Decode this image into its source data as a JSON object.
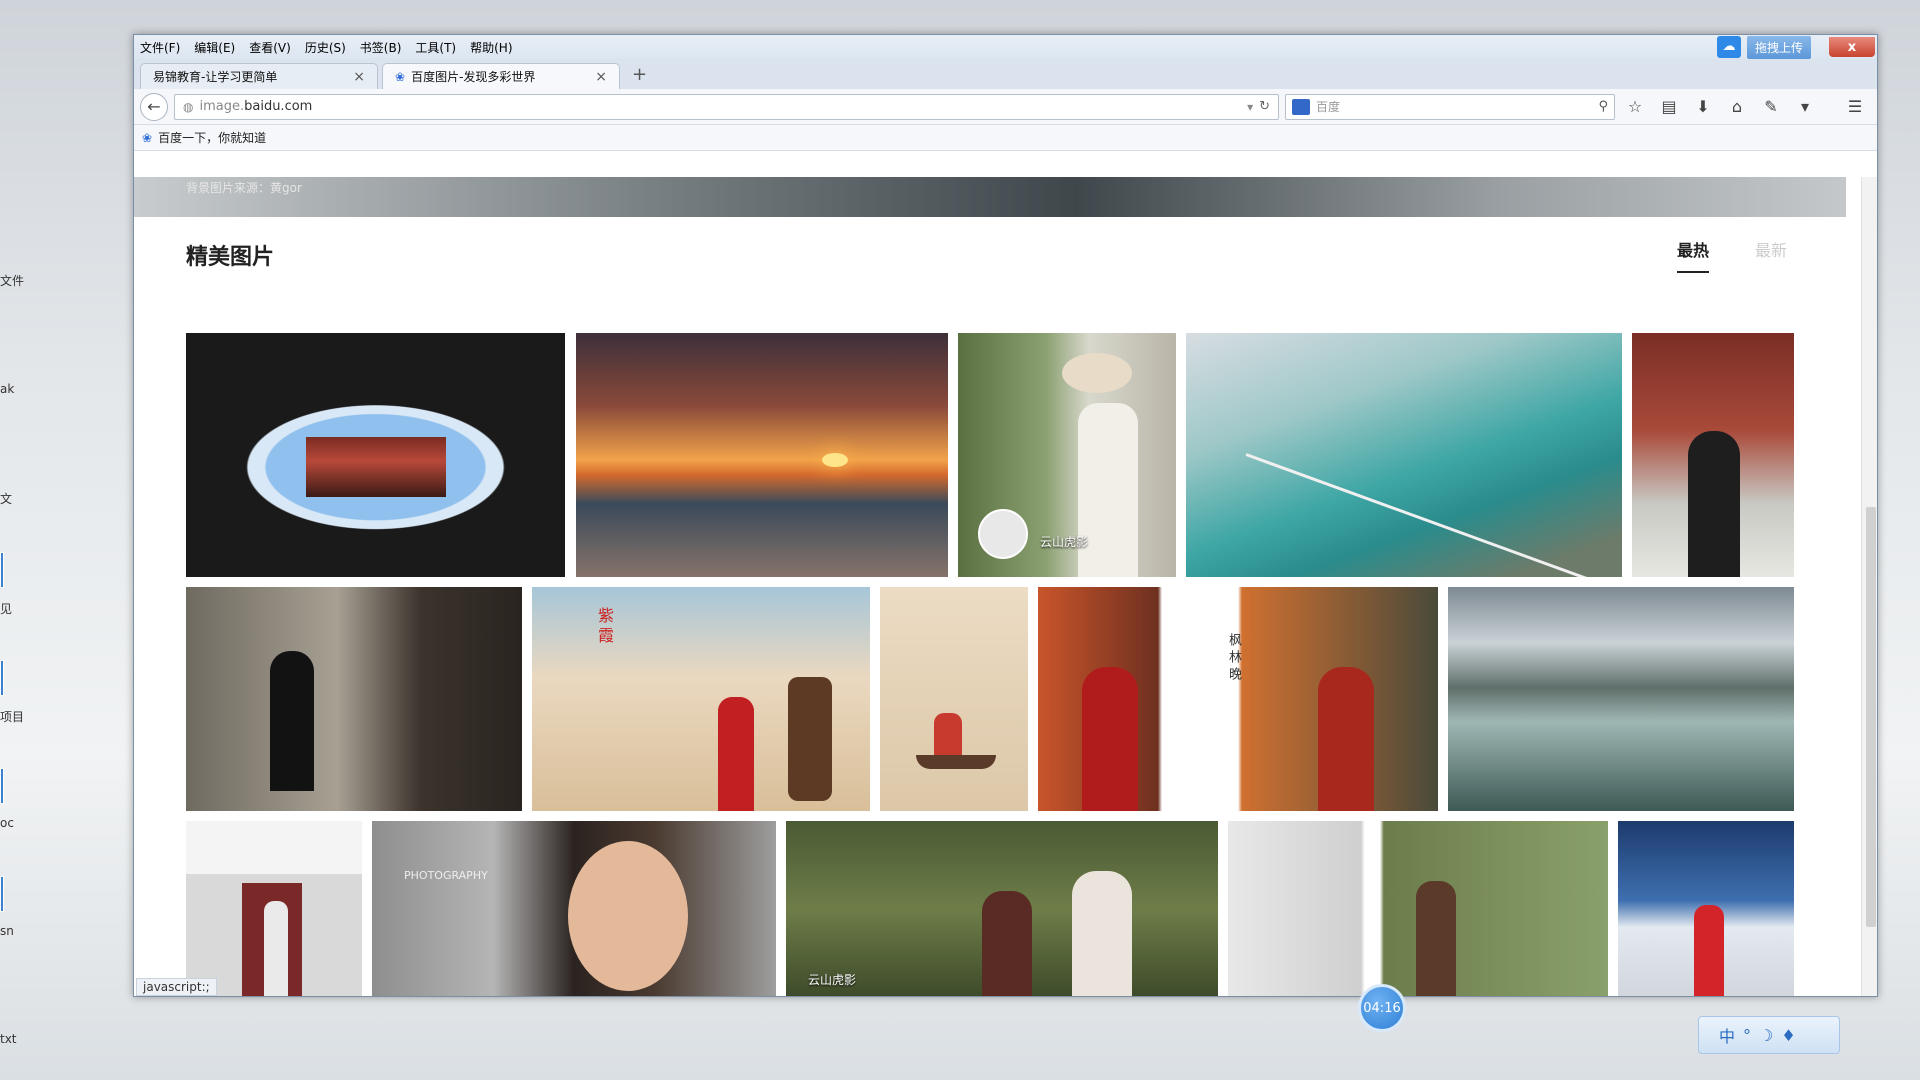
{
  "desktop": {
    "labels": [
      "文件",
      "ak",
      "文",
      "见",
      "项目",
      "oc",
      "sn",
      "txt"
    ]
  },
  "window": {
    "close_label": "x",
    "upload_label": "拖拽上传"
  },
  "menubar": {
    "items": [
      "文件(F)",
      "编辑(E)",
      "查看(V)",
      "历史(S)",
      "书签(B)",
      "工具(T)",
      "帮助(H)"
    ]
  },
  "tabs": [
    {
      "title": "易锦教育-让学习更简单",
      "active": false
    },
    {
      "title": "百度图片-发现多彩世界",
      "active": true
    }
  ],
  "new_tab_label": "+",
  "navbar": {
    "url_prefix": "image.",
    "url_host": "baidu.com",
    "search_placeholder": "百度"
  },
  "bookmarks": {
    "item": "百度一下，你就知道"
  },
  "page": {
    "banner_caption": "背景图片来源：黄gor",
    "section_title": "精美图片",
    "sort_tabs": [
      {
        "label": "最热",
        "active": true
      },
      {
        "label": "最新",
        "active": false
      }
    ],
    "photo_captions": {
      "hat_girl": "云山虎影",
      "red_dress_vertical": "枫林晚",
      "desert_vertical": "紫霞",
      "portrait_logo": "PHOTOGRAPHY",
      "picnic_watermark": "云山虎影"
    }
  },
  "status_bar": "javascript:;",
  "overlay": {
    "timer": "04:16",
    "ime_label": "中"
  },
  "colors": {
    "accent": "#2e6fd6",
    "close": "#c7432f",
    "timer": "#2f7fd6"
  }
}
